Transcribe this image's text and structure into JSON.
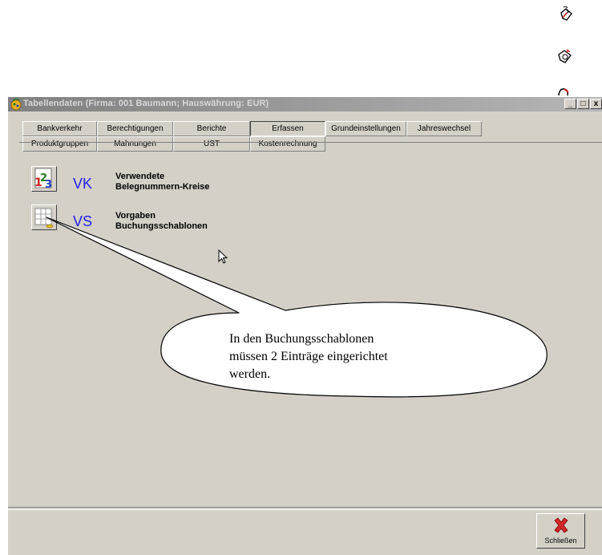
{
  "window": {
    "title": "Tabellendaten  (Firma: 001 Baumann;  Hauswährung: EUR)",
    "minimize_label": "_",
    "maximize_label": "□",
    "close_label": "x"
  },
  "tabs": {
    "row1": [
      "Bankverkehr",
      "Berechtigungen",
      "Berichte",
      "Erfassen",
      "Grundeinstellungen",
      "Jahreswechsel"
    ],
    "row2": [
      "Produktgruppen",
      "Mahnungen",
      "UST",
      "Kostenrechnung"
    ],
    "active": "Erfassen"
  },
  "items": [
    {
      "code": "VK",
      "line1": "Verwendete",
      "line2": "Belegnummern-Kreise",
      "icon": "numbers-123-icon"
    },
    {
      "code": "VS",
      "line1": "Vorgaben",
      "line2": "Buchungsschablonen",
      "icon": "template-grid-icon"
    }
  ],
  "close_button": {
    "label": "Schließen",
    "icon": "red-x-icon"
  },
  "callout": {
    "line1": "In den Buchungsschablonen",
    "line2": "müssen 2 Einträge eingerichtet",
    "line3": "werden."
  },
  "colors": {
    "code_blue": "#1f1fe8",
    "window_bg": "#d4d0c8",
    "close_red": "#cc2222"
  }
}
